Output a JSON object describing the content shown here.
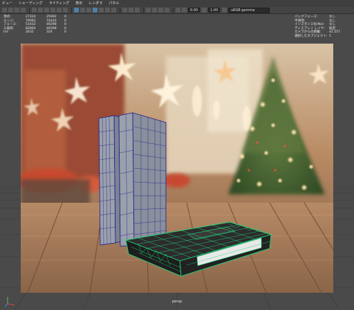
{
  "menu": [
    "ビュー",
    "シェーディング",
    "ライティング",
    "表示",
    "レンダラ",
    "パネル"
  ],
  "toolbar": {
    "value1": "0.00",
    "value2": "1.00",
    "color_space": "sRGB gamma"
  },
  "hud_left": {
    "rows": [
      {
        "label": "頂点:",
        "v1": "27324",
        "v2": "25092",
        "v3": "0"
      },
      {
        "label": "エッジ:",
        "v1": "79992",
        "v2": "74420",
        "v3": "0"
      },
      {
        "label": "フェース:",
        "v1": "51432",
        "v2": "49298",
        "v3": "0"
      },
      {
        "label": "三角形:",
        "v1": "82864",
        "v2": "49298",
        "v3": "0"
      },
      {
        "label": "UV:",
        "v1": "2632",
        "v2": "324",
        "v3": "0"
      }
    ]
  },
  "hud_right": {
    "rows": [
      {
        "label": "バックフェース:",
        "value": "なし"
      },
      {
        "label": "平滑性:",
        "value": "なし"
      },
      {
        "label": "インスタンス化(No):",
        "value": "なし"
      },
      {
        "label": "ディスプレイ レイヤ:",
        "value": "既定"
      },
      {
        "label": "カメラからの距離:",
        "value": "41.557"
      },
      {
        "label": "選択したオブジェクト:",
        "value": "1"
      }
    ]
  },
  "camera_name": "persp",
  "colors": {
    "wireframe_selected": "#1fd67a",
    "wireframe_unselected": "#1a1a8c",
    "viewport_bg": "#4a4a4a"
  }
}
